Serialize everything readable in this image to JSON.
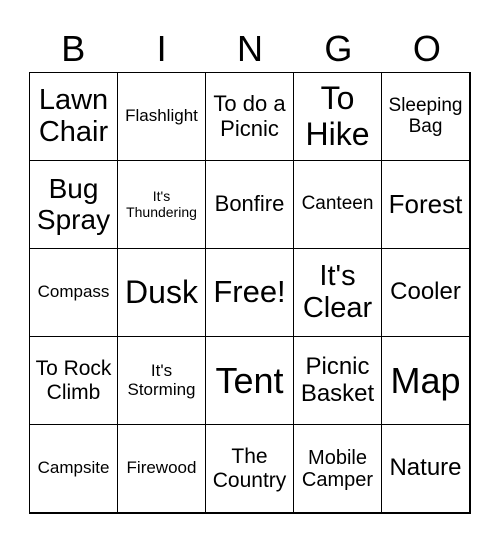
{
  "header": [
    "B",
    "I",
    "N",
    "G",
    "O"
  ],
  "cells": [
    "Lawn Chair",
    "Flashlight",
    "To do a Picnic",
    "To Hike",
    "Sleeping Bag",
    "Bug Spray",
    "It's Thundering",
    "Bonfire",
    "Canteen",
    "Forest",
    "Compass",
    "Dusk",
    "Free!",
    "It's Clear",
    "Cooler",
    "To Rock Climb",
    "It's Storming",
    "Tent",
    "Picnic Basket",
    "Map",
    "Campsite",
    "Firewood",
    "The Country",
    "Mobile Camper",
    "Nature"
  ]
}
